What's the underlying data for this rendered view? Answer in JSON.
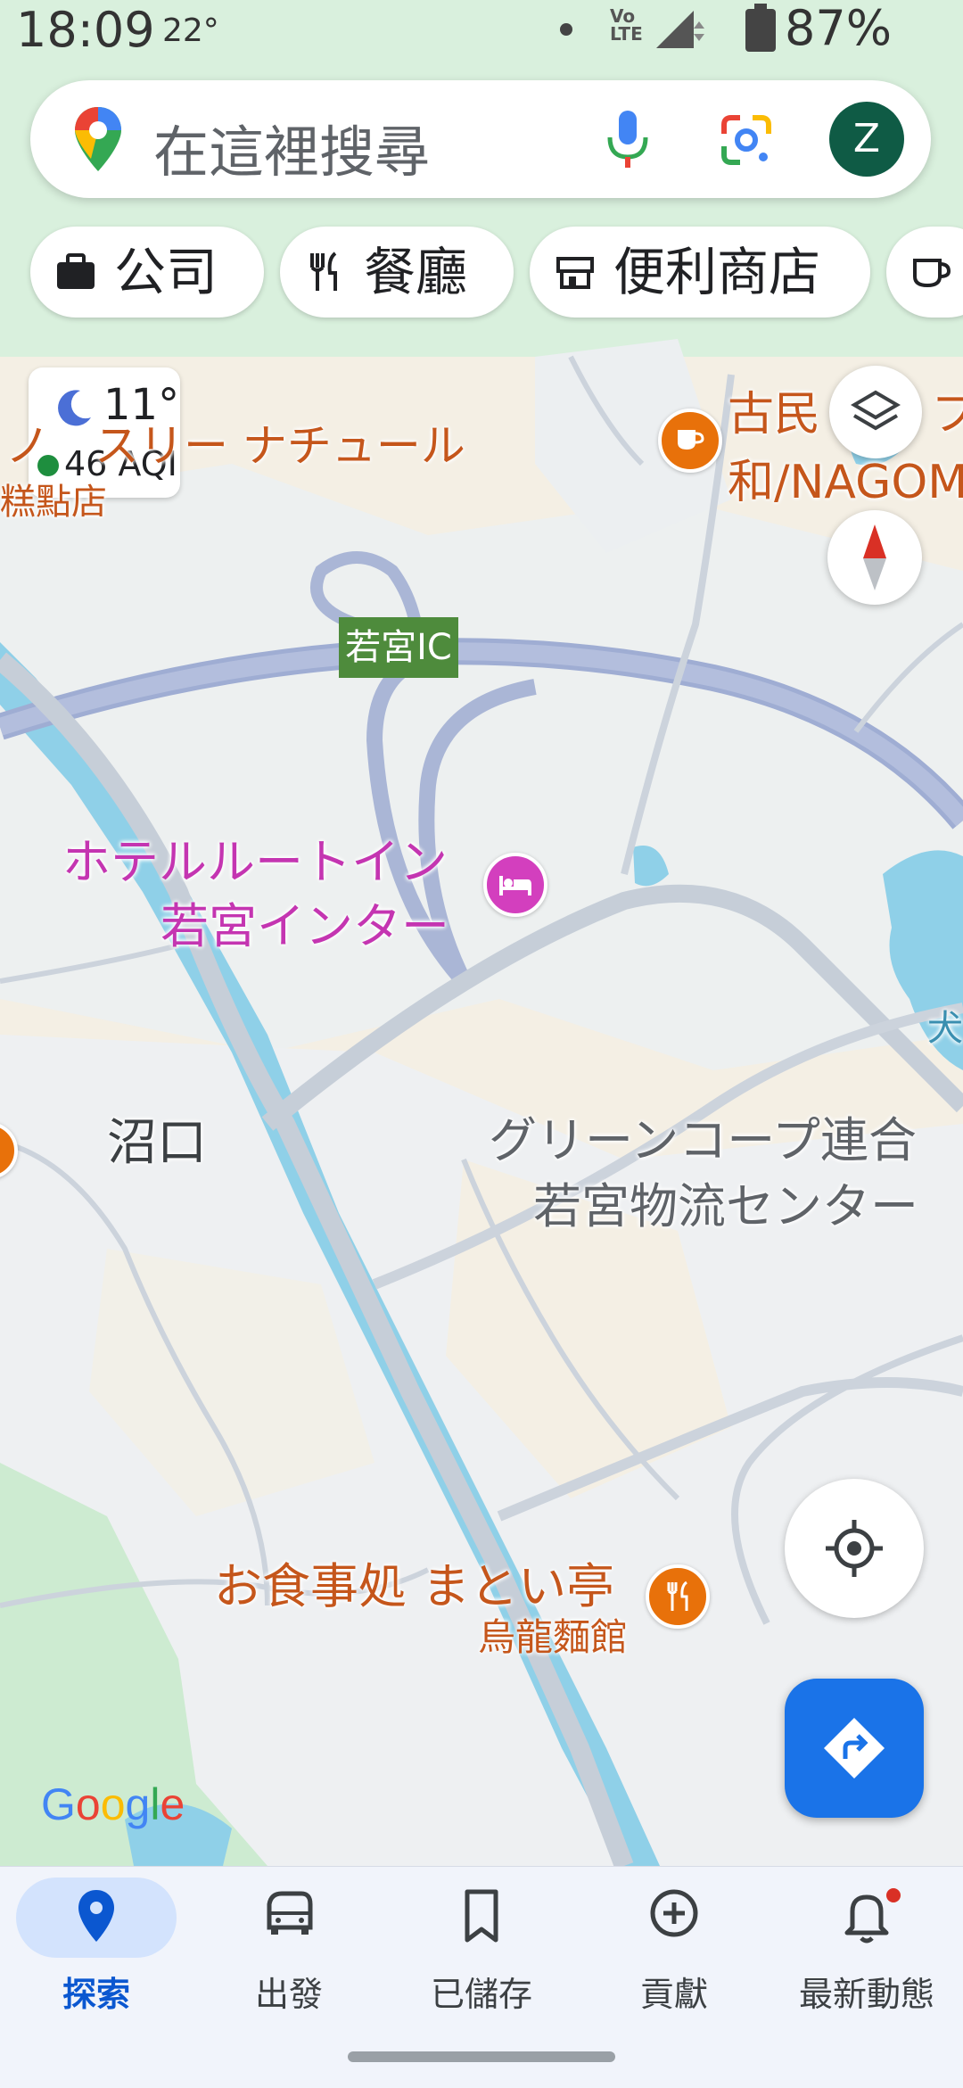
{
  "status_bar": {
    "time": "18:09",
    "temperature": "22°",
    "network": "Vo LTE",
    "battery": "87%"
  },
  "search": {
    "placeholder": "在這裡搜尋",
    "avatar_letter": "Z"
  },
  "chips": [
    {
      "label": "公司",
      "icon": "briefcase-icon"
    },
    {
      "label": "餐廳",
      "icon": "fork-knife-icon"
    },
    {
      "label": "便利商店",
      "icon": "store-icon"
    },
    {
      "label": "",
      "icon": "coffee-icon"
    }
  ],
  "weather": {
    "temperature": "11°",
    "aqi": "46 AQI"
  },
  "map": {
    "labels": {
      "top_cafe_partial": "ノ　スリー ナチュール",
      "top_left_partial": "糕點店",
      "kominka": "古民",
      "kominka_suffix": "フ",
      "nagomi": "和/NAGOM",
      "interchange": "若宮IC",
      "hotel_line1": "ホテルルートイン",
      "hotel_line2": "若宮インター",
      "numaguchi": "沼口",
      "coop_line1": "グリーンコープ連合",
      "coop_line2": "若宮物流センター",
      "restaurant_jp": "お食事処 まとい亭",
      "restaurant_zh": "烏龍麵館",
      "water_partial": "犬"
    },
    "logo": "Google"
  },
  "bottom_nav": [
    {
      "label": "探索",
      "icon": "location-pin-icon",
      "active": true
    },
    {
      "label": "出發",
      "icon": "car-icon",
      "active": false
    },
    {
      "label": "已儲存",
      "icon": "bookmark-icon",
      "active": false
    },
    {
      "label": "貢獻",
      "icon": "add-circle-icon",
      "active": false
    },
    {
      "label": "最新動態",
      "icon": "bell-icon",
      "active": false
    }
  ],
  "colors": {
    "primary": "#1a73e8",
    "active_nav": "#0b57d0",
    "poi_orange": "#e8710a",
    "poi_magenta": "#d33fbe",
    "water": "#8fd0e8",
    "park": "#cdebd1"
  }
}
